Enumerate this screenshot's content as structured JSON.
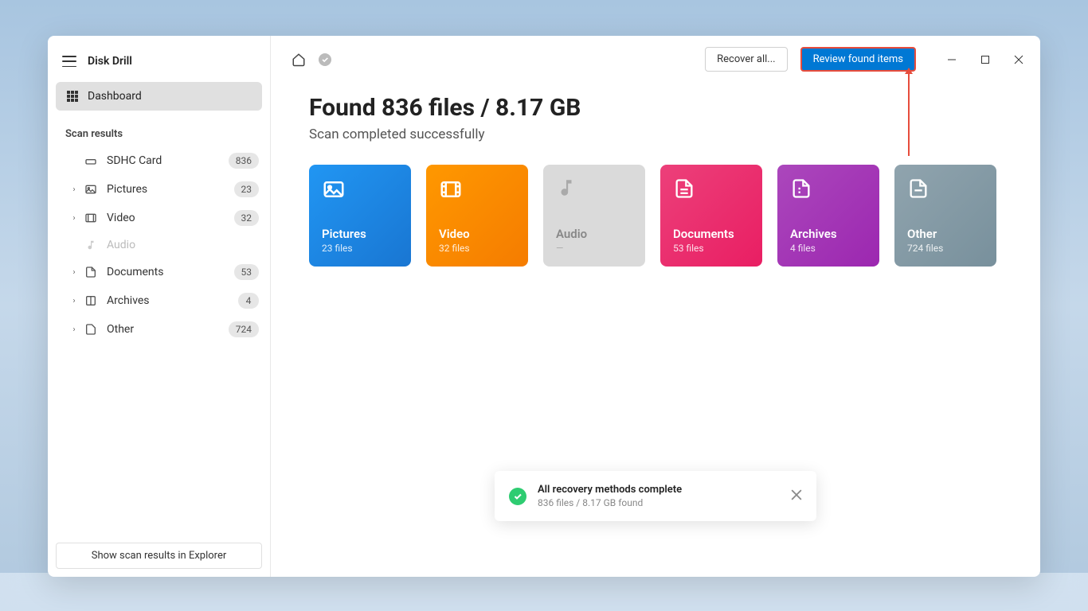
{
  "app": {
    "title": "Disk Drill"
  },
  "sidebar": {
    "dashboard": "Dashboard",
    "section": "Scan results",
    "items": [
      {
        "label": "SDHC Card",
        "badge": "836",
        "icon": "drive"
      },
      {
        "label": "Pictures",
        "badge": "23",
        "icon": "image",
        "expandable": true
      },
      {
        "label": "Video",
        "badge": "32",
        "icon": "video",
        "expandable": true
      },
      {
        "label": "Audio",
        "badge": "",
        "icon": "audio",
        "disabled": true
      },
      {
        "label": "Documents",
        "badge": "53",
        "icon": "document",
        "expandable": true
      },
      {
        "label": "Archives",
        "badge": "4",
        "icon": "archive",
        "expandable": true
      },
      {
        "label": "Other",
        "badge": "724",
        "icon": "other",
        "expandable": true
      }
    ],
    "footer_btn": "Show scan results in Explorer"
  },
  "topbar": {
    "recover_btn": "Recover all...",
    "review_btn": "Review found items"
  },
  "main": {
    "heading": "Found 836 files / 8.17 GB",
    "subheading": "Scan completed successfully",
    "cards": [
      {
        "title": "Pictures",
        "subtitle": "23 files",
        "class": "pictures"
      },
      {
        "title": "Video",
        "subtitle": "32 files",
        "class": "video"
      },
      {
        "title": "Audio",
        "subtitle": "—",
        "class": "audio"
      },
      {
        "title": "Documents",
        "subtitle": "53 files",
        "class": "documents"
      },
      {
        "title": "Archives",
        "subtitle": "4 files",
        "class": "archives"
      },
      {
        "title": "Other",
        "subtitle": "724 files",
        "class": "other"
      }
    ]
  },
  "toast": {
    "title": "All recovery methods complete",
    "subtitle": "836 files / 8.17 GB found"
  }
}
